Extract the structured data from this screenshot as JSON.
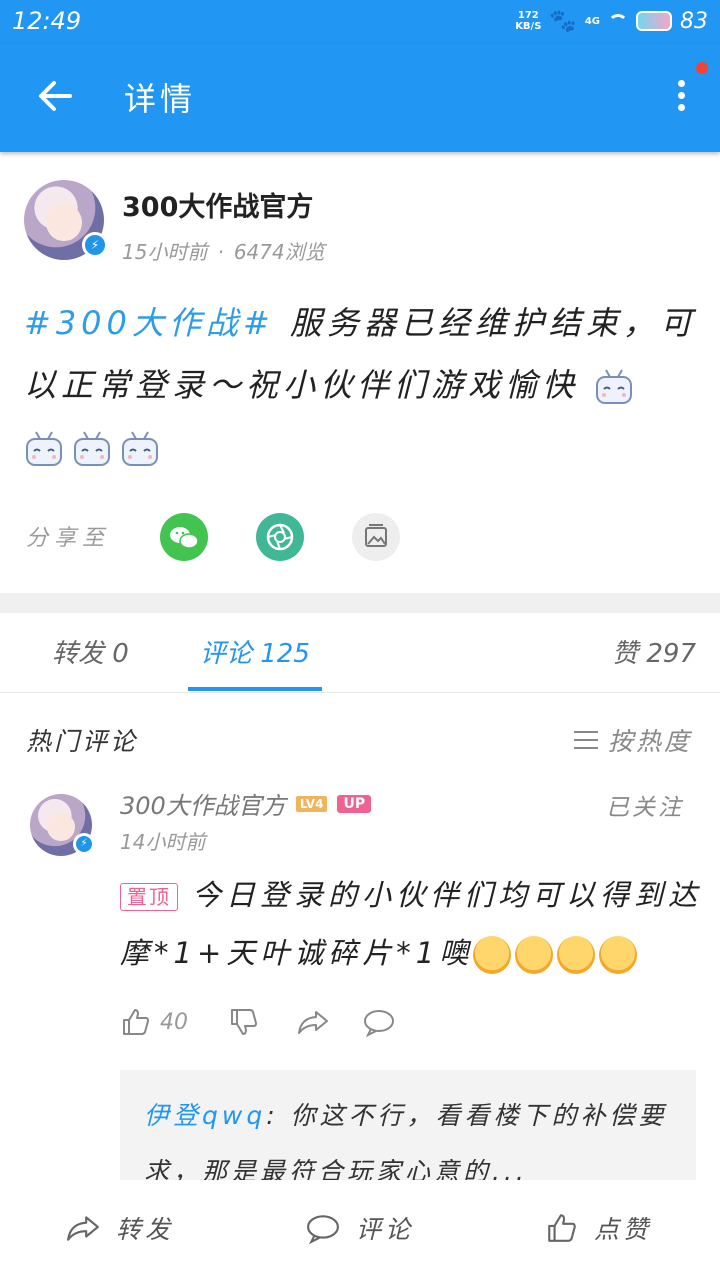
{
  "status_bar": {
    "time": "12:49",
    "net_speed_value": "172",
    "net_speed_unit": "KB/S",
    "network_type": "4G",
    "battery_level": "83"
  },
  "app_bar": {
    "title": "详情"
  },
  "post": {
    "author": "300大作战官方",
    "time_ago": "15小时前",
    "views": "6474浏览",
    "tag": "#300大作战#",
    "text": "服务器已经维护结束，可以正常登录～祝小伙伴们游戏愉快"
  },
  "share": {
    "label": "分享至"
  },
  "tabs": {
    "repost": "转发 0",
    "comments": "评论 125",
    "likes": "赞 297"
  },
  "hot_comments": {
    "title": "热门评论",
    "sort_label": "按热度"
  },
  "comment": {
    "author": "300大作战官方",
    "level": "LV4",
    "up_badge": "UP",
    "follow_status": "已关注",
    "time_ago": "14小时前",
    "pinned_label": "置顶",
    "text": "今日登录的小伙伴们均可以得到达摩*1+天叶诚碎片*1噢",
    "like_count": "40",
    "reply": {
      "user": "伊登qwq",
      "text": ": 你这不行，看看楼下的补偿要求，那是最符合玩家心意的..."
    }
  },
  "bottom_bar": {
    "repost": "转发",
    "comment": "评论",
    "like": "点赞"
  },
  "colors": {
    "primary": "#2196f3",
    "tag_blue": "#2c9de6",
    "pin_pink": "#f06292",
    "level_orange": "#f0b45c",
    "wechat_green": "#43c450"
  }
}
